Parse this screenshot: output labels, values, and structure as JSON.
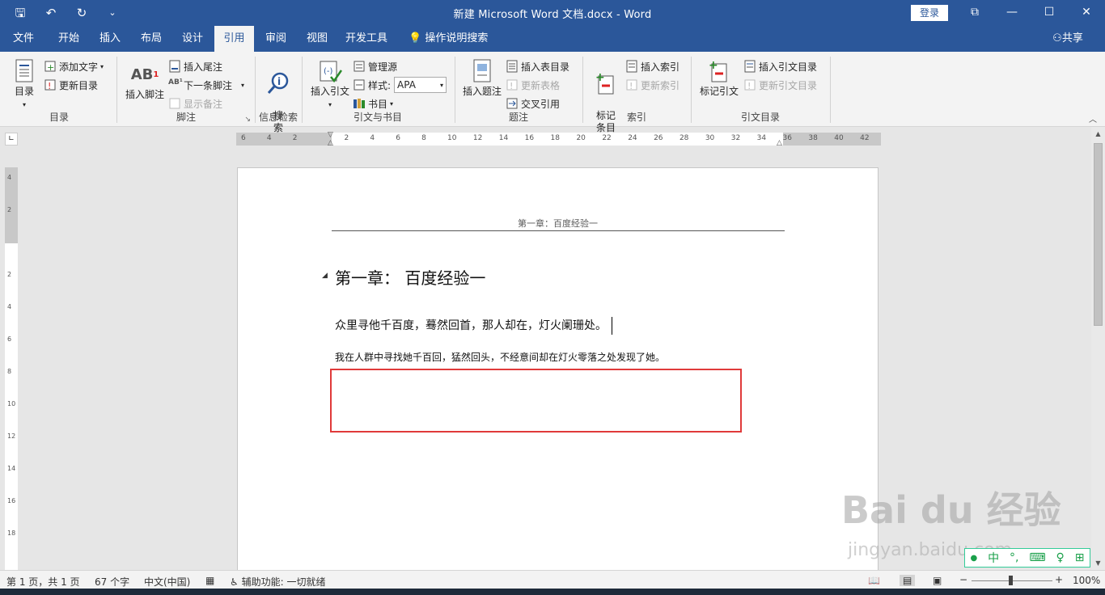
{
  "window": {
    "title": "新建 Microsoft Word 文档.docx  -  Word",
    "login": "登录",
    "min": "—",
    "max": "☐",
    "close": "✕",
    "restore": "⧉"
  },
  "qat": {
    "save": "🖫",
    "undo": "↶",
    "redo": "↻",
    "more": "⌄"
  },
  "tabs": [
    "文件",
    "开始",
    "插入",
    "布局",
    "设计",
    "引用",
    "审阅",
    "视图",
    "开发工具"
  ],
  "tell_me": "操作说明搜索",
  "share": "共享",
  "ribbon": {
    "toc": {
      "big": "目录",
      "add_text": "添加文字",
      "update": "更新目录",
      "label": "目录"
    },
    "footnotes": {
      "insert": "插入脚注",
      "endnote": "插入尾注",
      "next": "下一条脚注",
      "show": "显示备注",
      "label": "脚注"
    },
    "research": {
      "search": "搜\n索",
      "label": "信息检索"
    },
    "citations": {
      "insert": "插入引文",
      "manage": "管理源",
      "style_label": "样式:",
      "style_value": "APA",
      "bibliography": "书目",
      "label": "引文与书目"
    },
    "captions": {
      "insert": "插入题注",
      "table_of_figures": "插入表目录",
      "update_table": "更新表格",
      "cross_ref": "交叉引用",
      "label": "题注"
    },
    "index": {
      "mark": "标记\n条目",
      "insert": "插入索引",
      "update": "更新索引",
      "label": "索引"
    },
    "toa": {
      "mark": "标记引文",
      "insert": "插入引文目录",
      "update": "更新引文目录",
      "label": "引文目录"
    }
  },
  "ruler": {
    "labels": [
      "6",
      "4",
      "2",
      "",
      "2",
      "4",
      "6",
      "8",
      "10",
      "12",
      "14",
      "16",
      "18",
      "20",
      "22",
      "24",
      "26",
      "28",
      "30",
      "32",
      "34",
      "36",
      "38",
      "40",
      "42"
    ]
  },
  "vruler": {
    "labels": [
      "4",
      "2",
      "",
      "2",
      "4",
      "6",
      "8",
      "10",
      "12",
      "14",
      "16",
      "18"
    ]
  },
  "document": {
    "header": "第一章：百度经验一",
    "heading": "第一章：  百度经验一",
    "para1": "众里寻他千百度，蓦然回首，那人却在，灯火阑珊处。",
    "para2": "我在人群中寻找她千百回，猛然回头，不经意间却在灯火零落之处发现了她。"
  },
  "status": {
    "page": "第 1 页，共 1 页",
    "words": "67 个字",
    "lang": "中文(中国)",
    "accessibility": "辅助功能: 一切就绪",
    "zoom": "100%",
    "minus": "−",
    "plus": "+"
  },
  "watermark": {
    "brand": "Bai du 经验",
    "url": "jingyan.baidu.com"
  },
  "ime": {
    "chinese": "中",
    "items": [
      "●",
      "中",
      "°,",
      "⌨",
      "♀",
      "⊞"
    ]
  }
}
